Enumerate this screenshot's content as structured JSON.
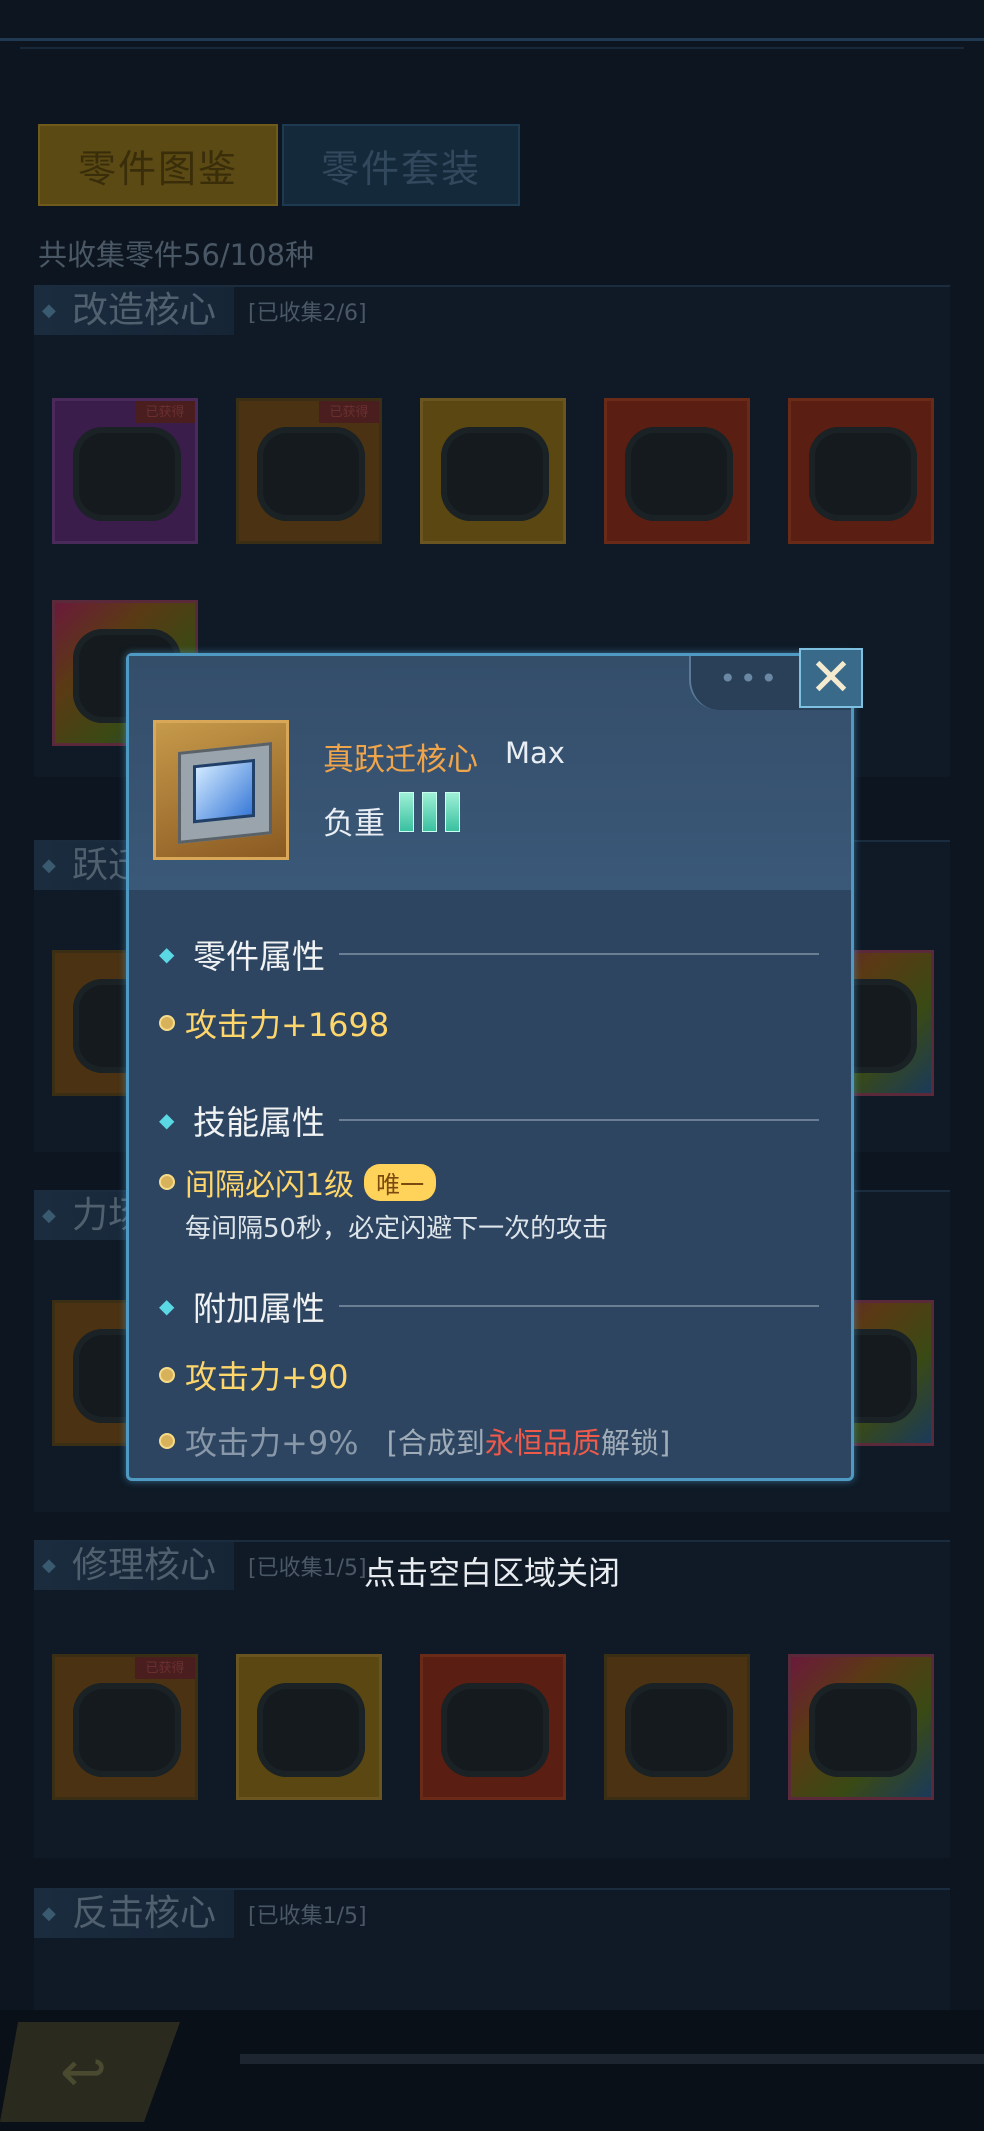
{
  "tabs": [
    {
      "label": "零件图鉴"
    },
    {
      "label": "零件套装"
    }
  ],
  "summary": "共收集零件56/108种",
  "sections": [
    {
      "title": "改造核心",
      "count": "[已收集2/6]"
    },
    {
      "title": "跃迁核心",
      "count": ""
    },
    {
      "title": "力场核心",
      "count": ""
    },
    {
      "title": "修理核心",
      "count": "[已收集1/5]"
    },
    {
      "title": "反击核心",
      "count": "[已收集1/5]"
    }
  ],
  "slot_tag": "已获得",
  "close_hint": "点击空白区域关闭",
  "popup": {
    "item_name": "真跃迁核心",
    "item_level": "Max",
    "load_label": "负重",
    "load_value": 3,
    "part_attr_heading": "零件属性",
    "part_attr": "攻击力+1698",
    "skill_attr_heading": "技能属性",
    "skill_name": "间隔必闪1级",
    "skill_badge": "唯一",
    "skill_desc": "每间隔50秒，必定闪避下一次的攻击",
    "extra_attr_heading": "附加属性",
    "extra_attr_1": "攻击力+90",
    "extra_attr_2": "攻击力+9%",
    "lock_prefix": "[合成到",
    "lock_highlight": "永恒品质",
    "lock_suffix": "解锁]",
    "close_icon": "close-icon"
  },
  "colors": {
    "accent_gold": "#ffd66a",
    "item_name_orange": "#f0a54a",
    "lock_red": "#f05a4a",
    "popup_border": "#4f9ac2"
  }
}
